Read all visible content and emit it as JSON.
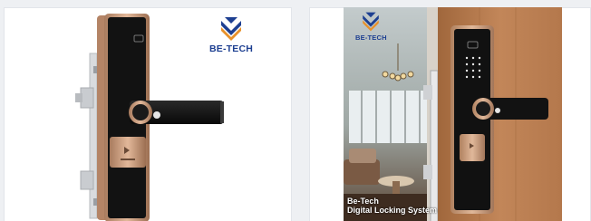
{
  "products": [
    {
      "brand": "BE-TECH",
      "image": "black-and-rose-gold-smart-door-lock"
    },
    {
      "brand": "BE-TECH",
      "image": "digital-door-lock-installed-on-wooden-door",
      "caption_line1": "Be-Tech",
      "caption_line2": "Digital Locking System"
    }
  ],
  "colors": {
    "brand_blue": "#1d3f91",
    "brand_orange": "#e8912a",
    "rose_gold": "#c89878",
    "lock_black": "#131313"
  }
}
